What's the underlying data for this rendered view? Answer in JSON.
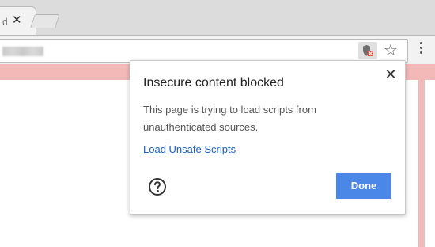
{
  "tab": {
    "title": "d",
    "close_symbol": "✕"
  },
  "toolbar": {
    "star_symbol": "☆"
  },
  "popup": {
    "title": "Insecure content blocked",
    "body": "This page is trying to load scripts from unauthenticated sources.",
    "link": "Load Unsafe Scripts",
    "close_symbol": "✕",
    "done_label": "Done"
  },
  "icons": {
    "shield": "insecure-shield-icon",
    "star": "star-icon",
    "menu": "kebab-menu-icon",
    "help": "help-icon",
    "close": "close-icon"
  },
  "colors": {
    "accent": "#4b87e7",
    "link": "#1a5fc8",
    "page_background": "#f3b9b9",
    "shield_badge": "#e44f3a"
  }
}
